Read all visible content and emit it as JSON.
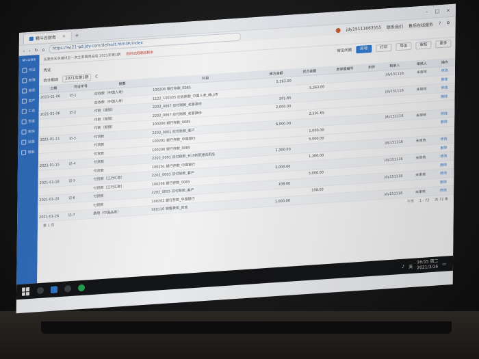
{
  "browser": {
    "tab_title": "精斗云财务",
    "url": "https://wj21-gd.jdy.com/default.html#/index"
  },
  "user_bar": {
    "user": "jdy15111663555",
    "contact": "联系我们",
    "service": "售后在线服务"
  },
  "topline": {
    "company": "东莞市天孚通讯五一女士发展用品店 2021年第1期",
    "warn": "您的试用期还剩余"
  },
  "sidebar": {
    "logo": "精斗云财务",
    "items": [
      {
        "label": "凭证"
      },
      {
        "label": "账簿"
      },
      {
        "label": "报表"
      },
      {
        "label": "资产"
      },
      {
        "label": "工资"
      },
      {
        "label": "现金"
      },
      {
        "label": "税务"
      },
      {
        "label": "设置"
      },
      {
        "label": "智能"
      }
    ]
  },
  "toolbar": {
    "breadcrumb": "凭证",
    "checkbox_label": "常见问题",
    "new": "新增",
    "print": "打印",
    "export": "导出",
    "audit": "审核",
    "more": "更多"
  },
  "subbar": {
    "period_label": "会计期间",
    "period_value": "2021年第1期",
    "refresh": "C"
  },
  "table": {
    "headers": [
      "日期",
      "凭证字号",
      "摘要",
      "科目",
      "借方金额",
      "贷方金额",
      "原单据编号",
      "附件",
      "制单人",
      "审核人",
      "操作"
    ],
    "rows": [
      {
        "date": "2021-01-06",
        "no": "记-1",
        "summary": "应收款（中国人寿）",
        "subject": "100206 银行存款_0085",
        "debit": "5,363.00",
        "credit": "",
        "attach": "",
        "maker": "jdy151116",
        "auditor": "未审核",
        "op": "修改"
      },
      {
        "date": "",
        "no": "",
        "summary": "应收款（中国人寿）",
        "subject": "1122_100305 应收账款_中国人寿_佛山市",
        "debit": "",
        "credit": "5,363.00",
        "attach": "",
        "maker": "",
        "auditor": "",
        "op": "删除"
      },
      {
        "date": "2021-01-06",
        "no": "记-2",
        "summary": "付款（报销）",
        "subject": "2202_0067 应付账款_老客报还",
        "debit": "501.65",
        "credit": "",
        "attach": "",
        "maker": "jdy151116",
        "auditor": "未审核",
        "op": "修改"
      },
      {
        "date": "",
        "no": "",
        "summary": "付款（报销）",
        "subject": "2202_0067 应付账款_老客报还",
        "debit": "2,000.00",
        "credit": "",
        "attach": "",
        "maker": "",
        "auditor": "",
        "op": "删除"
      },
      {
        "date": "",
        "no": "",
        "summary": "付款（报销）",
        "subject": "100206 银行存款_0085",
        "debit": "",
        "credit": "2,501.65",
        "attach": "",
        "maker": "",
        "auditor": "",
        "op": ""
      },
      {
        "date": "2021-01-11",
        "no": "记-3",
        "summary": "付货款",
        "subject": "2202_0001 应付账款_客户",
        "debit": "6,000.00",
        "credit": "",
        "attach": "",
        "maker": "jdy151116",
        "auditor": "未审核",
        "op": "修改"
      },
      {
        "date": "",
        "no": "",
        "summary": "付货款",
        "subject": "100201 银行存款_中国银行",
        "debit": "",
        "credit": "1,000.00",
        "attach": "",
        "maker": "",
        "auditor": "",
        "op": "删除"
      },
      {
        "date": "",
        "no": "",
        "summary": "付货款",
        "subject": "100206 银行存款_0085",
        "debit": "",
        "credit": "5,000.00",
        "attach": "",
        "maker": "",
        "auditor": "",
        "op": ""
      },
      {
        "date": "2021-01-15",
        "no": "记-4",
        "summary": "付货款",
        "subject": "2202_0091 应付账款_长沙新意通讯用品",
        "debit": "1,300.00",
        "credit": "",
        "attach": "",
        "maker": "jdy151116",
        "auditor": "未审核",
        "op": "修改"
      },
      {
        "date": "",
        "no": "",
        "summary": "付货款",
        "subject": "100201 银行存款_中国银行",
        "debit": "",
        "credit": "1,300.00",
        "attach": "",
        "maker": "",
        "auditor": "",
        "op": "删除"
      },
      {
        "date": "2021-01-18",
        "no": "记-5",
        "summary": "付货款（工行汇款）",
        "subject": "2202_0003 应付账款_客户",
        "debit": "5,000.00",
        "credit": "",
        "attach": "",
        "maker": "jdy151116",
        "auditor": "未审核",
        "op": "修改"
      },
      {
        "date": "",
        "no": "",
        "summary": "付货款（工行汇款）",
        "subject": "100206 银行存款_0085",
        "debit": "",
        "credit": "5,000.00",
        "attach": "",
        "maker": "",
        "auditor": "",
        "op": "删除"
      },
      {
        "date": "2021-01-20",
        "no": "记-6",
        "summary": "付货款",
        "subject": "2202_0005 应付账款_客户",
        "debit": "108.00",
        "credit": "",
        "attach": "",
        "maker": "jdy151116",
        "auditor": "未审核",
        "op": "修改"
      },
      {
        "date": "",
        "no": "",
        "summary": "付货款",
        "subject": "100201 银行存款_中国银行",
        "debit": "",
        "credit": "108.00",
        "attach": "",
        "maker": "",
        "auditor": "",
        "op": "删除"
      },
      {
        "date": "2021-01-26",
        "no": "记-7",
        "summary": "费用（中国品类）",
        "subject": "560110 销售费用_其他",
        "debit": "1,000.00",
        "credit": "",
        "attach": "",
        "maker": "jdy151116",
        "auditor": "未审核",
        "op": "修改"
      }
    ]
  },
  "pager": {
    "page": "第 1 页",
    "next": "下页",
    "count": "1 - 72",
    "total": "共 72 条"
  },
  "taskbar": {
    "time": "16:55 周二",
    "date": "2021/3/16",
    "lang": "英"
  }
}
